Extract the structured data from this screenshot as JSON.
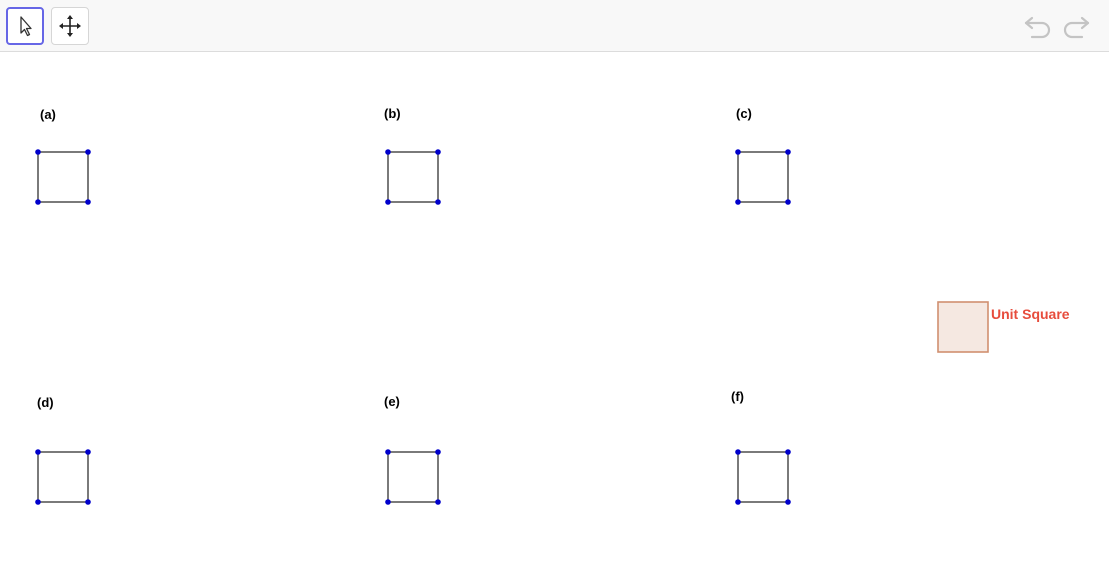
{
  "toolbar": {
    "tools": [
      {
        "icon": "pointer-arrow-icon",
        "active": true
      },
      {
        "icon": "move-cross-icon",
        "active": false
      }
    ],
    "history": [
      {
        "icon": "undo-icon",
        "enabled": false
      },
      {
        "icon": "redo-icon",
        "enabled": false
      }
    ]
  },
  "colors": {
    "accent": "#6666e6",
    "point": "#0000cc",
    "segment": "#333333",
    "unit_square_fill": "#f5e8e1",
    "unit_square_stroke": "#d08f70",
    "unit_label": "#e74c3c"
  },
  "figures": [
    {
      "label": "(a)"
    },
    {
      "label": "(b)"
    },
    {
      "label": "(c)"
    },
    {
      "label": "(d)"
    },
    {
      "label": "(e)"
    },
    {
      "label": "(f)"
    }
  ],
  "unit_square": {
    "label": "Unit Square"
  }
}
